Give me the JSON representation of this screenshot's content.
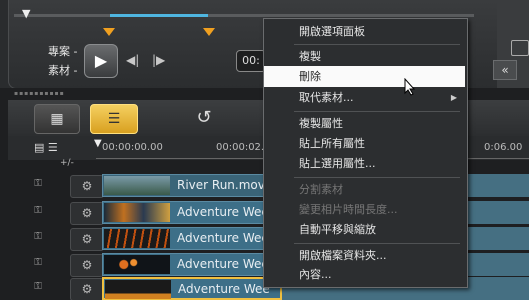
{
  "top_panel": {
    "label_project": "專案 -",
    "label_clip": "素材 -",
    "play_icon": "play-icon",
    "prev_frame": "◀|",
    "next_frame": "|▶",
    "timecode": "00:"
  },
  "toolbar": {
    "collapse": "«"
  },
  "ruler": {
    "start": "00:00:00.00",
    "mid": "00:00:02.0",
    "end": "0:06.00",
    "add_remove": "+/-"
  },
  "tracks": [
    {
      "label": "River Run.mov"
    },
    {
      "label": "Adventure Wee"
    },
    {
      "label": "Adventure Wee"
    },
    {
      "label": "Adventure Wee"
    },
    {
      "label": "Adventure Wee"
    }
  ],
  "context_menu": {
    "items": [
      {
        "label": "開啟選項面板"
      },
      {
        "label": "複製"
      },
      {
        "label": "刪除"
      },
      {
        "label": "取代素材..."
      },
      {
        "label": "複製屬性"
      },
      {
        "label": "貼上所有屬性"
      },
      {
        "label": "貼上選用屬性..."
      },
      {
        "label": "分割素材"
      },
      {
        "label": "變更相片時間長度..."
      },
      {
        "label": "自動平移與縮放"
      },
      {
        "label": "開啟檔案資料夾..."
      },
      {
        "label": "內容..."
      }
    ]
  },
  "colors": {
    "highlight": "#fafafa",
    "timeline_accent": "#f0c040",
    "clip": "#3d6f88",
    "scrub_range": "#4fb6e0"
  }
}
